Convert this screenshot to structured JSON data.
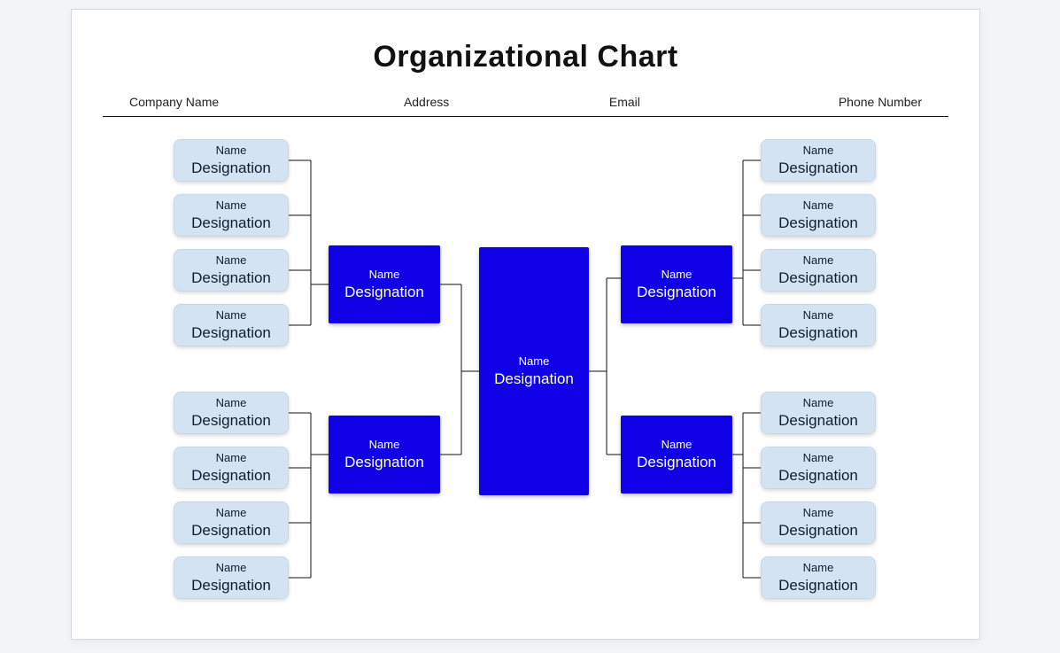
{
  "title": "Organizational Chart",
  "header": {
    "company": "Company Name",
    "address": "Address",
    "email": "Email",
    "phone": "Phone Number"
  },
  "root": {
    "name": "Name",
    "designation": "Designation"
  },
  "mids": {
    "tl": {
      "name": "Name",
      "designation": "Designation"
    },
    "bl": {
      "name": "Name",
      "designation": "Designation"
    },
    "tr": {
      "name": "Name",
      "designation": "Designation"
    },
    "br": {
      "name": "Name",
      "designation": "Designation"
    }
  },
  "leaves": {
    "tl": [
      {
        "name": "Name",
        "designation": "Designation"
      },
      {
        "name": "Name",
        "designation": "Designation"
      },
      {
        "name": "Name",
        "designation": "Designation"
      },
      {
        "name": "Name",
        "designation": "Designation"
      }
    ],
    "bl": [
      {
        "name": "Name",
        "designation": "Designation"
      },
      {
        "name": "Name",
        "designation": "Designation"
      },
      {
        "name": "Name",
        "designation": "Designation"
      },
      {
        "name": "Name",
        "designation": "Designation"
      }
    ],
    "tr": [
      {
        "name": "Name",
        "designation": "Designation"
      },
      {
        "name": "Name",
        "designation": "Designation"
      },
      {
        "name": "Name",
        "designation": "Designation"
      },
      {
        "name": "Name",
        "designation": "Designation"
      }
    ],
    "br": [
      {
        "name": "Name",
        "designation": "Designation"
      },
      {
        "name": "Name",
        "designation": "Designation"
      },
      {
        "name": "Name",
        "designation": "Designation"
      },
      {
        "name": "Name",
        "designation": "Designation"
      }
    ]
  }
}
